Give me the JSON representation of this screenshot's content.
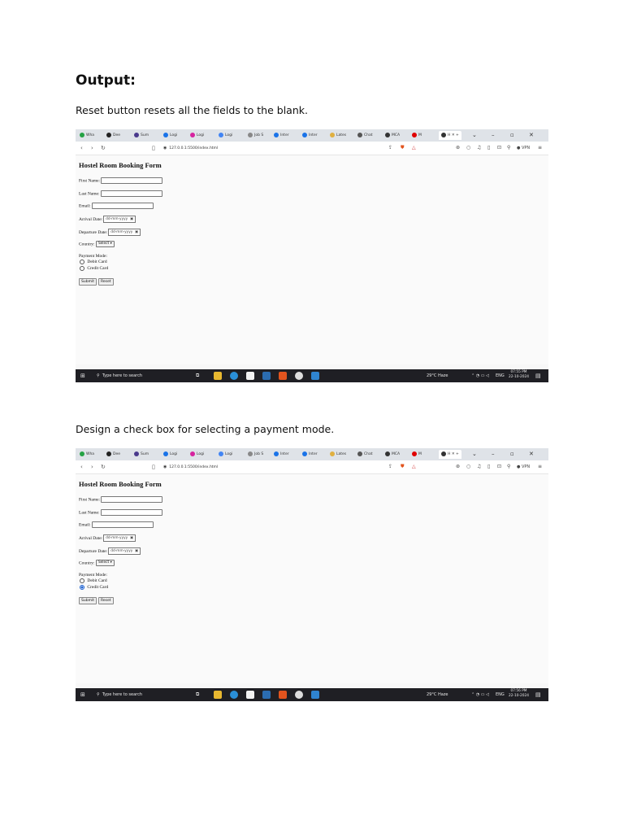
{
  "heading": "Output:",
  "caption1": "Reset button resets all the fields to the blank.",
  "caption2": "Design a check box for selecting a payment mode.",
  "browser": {
    "tabs": [
      {
        "label": "Wha",
        "color": "#25a244"
      },
      {
        "label": "Dee",
        "color": "#222222"
      },
      {
        "label": "Sum",
        "color": "#4a3a8c"
      },
      {
        "label": "Logi",
        "color": "#1a73e8"
      },
      {
        "label": "Logi",
        "color": "#d6249f"
      },
      {
        "label": "Logi",
        "color": "#4285f4"
      },
      {
        "label": "Job S",
        "color": "#888888"
      },
      {
        "label": "Inter",
        "color": "#1a73e8"
      },
      {
        "label": "Inter",
        "color": "#1a73e8"
      },
      {
        "label": "Lates",
        "color": "#e0b040"
      },
      {
        "label": "Chat",
        "color": "#555555"
      },
      {
        "label": "MCA",
        "color": "#333333"
      },
      {
        "label": "M",
        "color": "#e00000"
      },
      {
        "label": "H",
        "color": "#333333"
      }
    ],
    "url": "127.0.0.1:5500/index.html",
    "vpn": "VPN"
  },
  "form": {
    "title": "Hostel Room Booking Form",
    "first_name": "First Name:",
    "last_name": "Last Name:",
    "email": "Email:",
    "arrival": "Arrival Date:",
    "departure": "Departure Date:",
    "date_placeholder": "dd-mm-yyyy",
    "country": "Country:",
    "country_select": "Select",
    "payment_mode": "Payment Mode:",
    "debit": "Debit Card",
    "credit": "Credit Card",
    "submit": "Submit",
    "reset": "Reset"
  },
  "taskbar": {
    "search": "Type here to search",
    "weather": "29°C  Haze",
    "lang": "ENG",
    "time1": "07:55 PM",
    "time2": "07:56 PM",
    "date": "22-10-2024"
  },
  "screens": [
    {
      "credit_selected": false
    },
    {
      "credit_selected": true
    }
  ]
}
